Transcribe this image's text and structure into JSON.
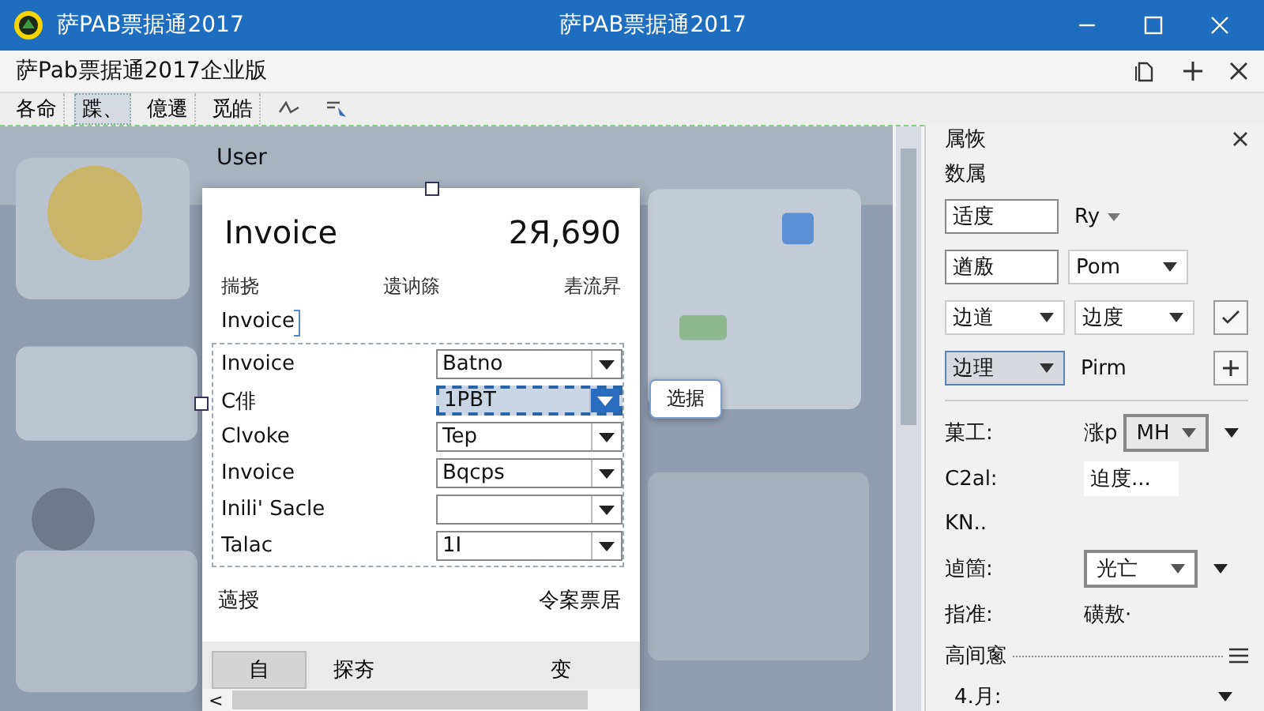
{
  "window": {
    "title": "萨PAB票据通2017",
    "caption": "萨PAB票据通2017"
  },
  "app_header": {
    "title": "萨Pab票据通2017企业版"
  },
  "toolbar": [
    {
      "kind": "text",
      "label": "各命",
      "selected": false
    },
    {
      "kind": "text",
      "label": "蹀、",
      "selected": true
    },
    {
      "kind": "text",
      "label": "億遷",
      "selected": false
    },
    {
      "kind": "text",
      "label": "觅皓",
      "selected": false
    },
    {
      "kind": "wave",
      "selected": false
    },
    {
      "kind": "pointer",
      "selected": false
    }
  ],
  "canvas": {
    "label": "User",
    "dialog": {
      "title": "Invoice",
      "amount": "2Я,690",
      "columns": [
        "揣挠",
        "遗讷篨",
        "砉流昇"
      ],
      "subtitle": "Invoice",
      "rows": [
        {
          "label": "Invoice",
          "value": "Batno",
          "selected": false
        },
        {
          "label": "C俳",
          "value": "1PBT",
          "selected": true,
          "tooltip": "选据"
        },
        {
          "label": "Clvoke",
          "value": "Tep",
          "selected": false
        },
        {
          "label": "Invoice",
          "value": "Bqcps",
          "selected": false
        },
        {
          "label": "Inili' Sacle",
          "value": "",
          "selected": false
        },
        {
          "label": "Talac",
          "value": "1I",
          "selected": false
        }
      ],
      "footer_left": "薖授",
      "footer_right": "令案票居",
      "tabs": [
        {
          "label": "自",
          "selected": true
        },
        {
          "label": "探夯",
          "selected": false
        },
        {
          "label": "变",
          "selected": false
        }
      ],
      "scroll_left": "<"
    }
  },
  "panel": {
    "title": "属恢",
    "section": "数属",
    "rows": [
      [
        {
          "kind": "field",
          "value": "适度"
        },
        {
          "kind": "dropdown-text",
          "value": "Ry"
        }
      ],
      [
        {
          "kind": "field",
          "value": "遒廒"
        },
        {
          "kind": "select",
          "value": "Pom",
          "selected": false
        }
      ],
      [
        {
          "kind": "select",
          "value": "边道",
          "selected": false
        },
        {
          "kind": "select",
          "value": "边度",
          "selected": false
        },
        {
          "kind": "check-button"
        }
      ],
      [
        {
          "kind": "select",
          "value": "边理",
          "selected": true
        },
        {
          "kind": "text",
          "value": "Pirm"
        },
        {
          "kind": "plus-button"
        }
      ]
    ],
    "form": [
      {
        "label": "菓工:",
        "controls": [
          {
            "kind": "text",
            "value": "涨p"
          },
          {
            "kind": "select",
            "value": "MH",
            "selected": true
          },
          {
            "kind": "caret"
          }
        ]
      },
      {
        "label": "C2al:",
        "controls": [
          {
            "kind": "field",
            "value": "迫度..."
          }
        ]
      },
      {
        "label": "KN.."
      },
      {
        "label": "逌箇:",
        "controls": [
          {
            "kind": "select",
            "value": "光亡",
            "selected": true
          },
          {
            "kind": "caret"
          }
        ]
      },
      {
        "label": "指准:",
        "controls": [
          {
            "kind": "text",
            "value": "磺敖·"
          }
        ]
      }
    ],
    "group": "高间窻",
    "last": {
      "label": "4.月:"
    }
  }
}
